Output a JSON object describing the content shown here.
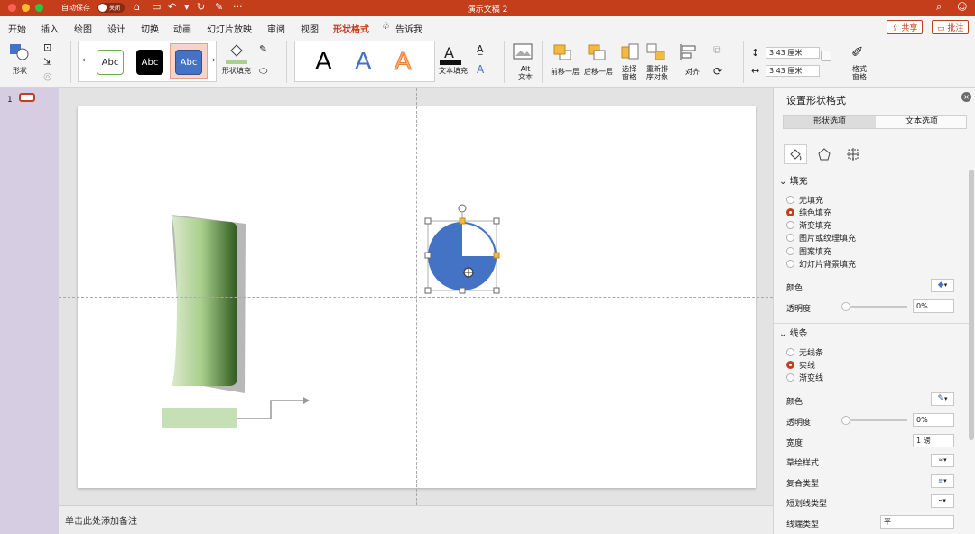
{
  "titlebar": {
    "autosave_label": "自动保存",
    "autosave_state": "关闭",
    "doc_title": "演示文稿 2"
  },
  "tabs": [
    "开始",
    "插入",
    "绘图",
    "设计",
    "切换",
    "动画",
    "幻灯片放映",
    "审阅",
    "视图",
    "形状格式"
  ],
  "tell_me": "告诉我",
  "share_label": "共享",
  "comment_label": "批注",
  "ribbon": {
    "shape_label": "形状",
    "styles": [
      "Abc",
      "Abc",
      "Abc"
    ],
    "shape_fill_label": "形状填充",
    "wordart": [
      "A",
      "A",
      "A"
    ],
    "text_fill_label": "文本填充",
    "alt_text_label": [
      "Alt",
      "文本"
    ],
    "bring_forward_label": "前移一层",
    "send_backward_label": "后移一层",
    "selection_pane_label": [
      "选择",
      "窗格"
    ],
    "reorder_label": [
      "重新排",
      "序对象"
    ],
    "align_label": "对齐",
    "height_value": "3.43 厘米",
    "width_value": "3.43 厘米",
    "format_pane_label": [
      "格式",
      "窗格"
    ]
  },
  "thumbnail": {
    "number": "1"
  },
  "notes_placeholder": "单击此处添加备注",
  "pane": {
    "title": "设置形状格式",
    "tab_shape": "形状选项",
    "tab_text": "文本选项",
    "fill": {
      "title": "填充",
      "options": [
        "无填充",
        "纯色填充",
        "渐变填充",
        "图片或纹理填充",
        "图案填充",
        "幻灯片背景填充"
      ],
      "selected": 1,
      "color_label": "颜色",
      "transparency_label": "透明度",
      "transparency_value": "0%"
    },
    "line": {
      "title": "线条",
      "options": [
        "无线条",
        "实线",
        "渐变线"
      ],
      "selected": 1,
      "color_label": "颜色",
      "transparency_label": "透明度",
      "transparency_value": "0%",
      "width_label": "宽度",
      "width_value": "1 磅",
      "sketch_label": "草绘样式",
      "compound_label": "复合类型",
      "dash_label": "短划线类型",
      "cap_label": "线端类型",
      "cap_value": "平"
    }
  },
  "colors": {
    "accent": "#c43e1c",
    "pie_blue": "#4472c4",
    "green_light": "#c5e0b4",
    "green_dark": "#375623"
  }
}
